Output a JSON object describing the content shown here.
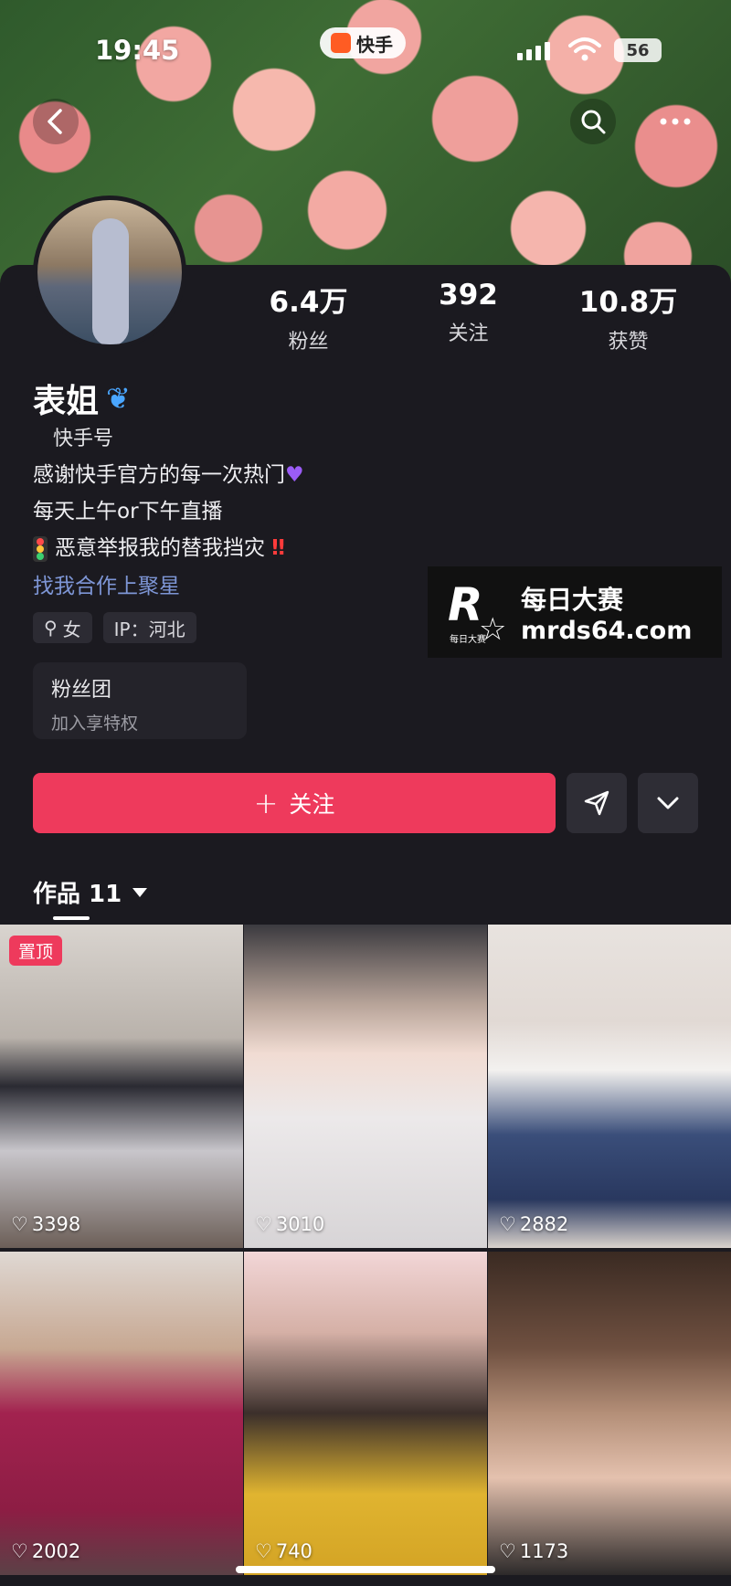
{
  "status_bar": {
    "time": "19:45",
    "app_name": "快手",
    "battery": "56"
  },
  "nav": {
    "back_icon": "chevron-left-icon",
    "search_icon": "search-icon",
    "more_icon": "more-icon"
  },
  "profile": {
    "stats": [
      {
        "value": "6.4万",
        "label": "粉丝"
      },
      {
        "value": "392",
        "label": "关注"
      },
      {
        "value": "10.8万",
        "label": "获赞"
      }
    ],
    "name": "表姐",
    "kuaishou_id": "快手号",
    "bio": {
      "line1": "感谢快手官方的每一次热门",
      "line2": "每天上午or下午直播",
      "line3": "恶意举报我的替我挡灾"
    },
    "link": "找我合作上聚星",
    "tags": {
      "gender": "女",
      "ip": "IP：河北"
    },
    "fan_club": {
      "title": "粉丝团",
      "subtitle": "加入享特权"
    }
  },
  "actions": {
    "follow_label": "关注"
  },
  "works": {
    "label": "作品 11"
  },
  "watermark": {
    "cn": "每日大赛",
    "url": "mrds64.com",
    "mini": "每日大赛"
  },
  "videos": [
    {
      "likes": "3398",
      "pinned_label": "置顶"
    },
    {
      "likes": "3010"
    },
    {
      "likes": "2882"
    },
    {
      "likes": "2002"
    },
    {
      "likes": "740"
    },
    {
      "likes": "1173"
    }
  ],
  "colors": {
    "accent": "#ee3a5c",
    "background": "#1b1a20",
    "link": "#7e96d6"
  }
}
